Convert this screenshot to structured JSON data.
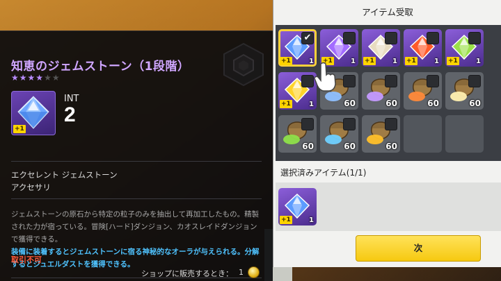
{
  "tooltip": {
    "item_name": "知恵のジェムストーン（1段階）",
    "stars": [
      "on",
      "on",
      "on",
      "on",
      "off",
      "off"
    ],
    "stat": {
      "name": "INT",
      "value": "2"
    },
    "enhance_badge": "+1",
    "category_line1": "エクセレント ジェムストーン",
    "category_line2": "アクセサリ",
    "description": "ジェムストーンの原石から特定の粒子のみを抽出して再加工したもの。精製された力が宿っている。冒険[ハード]ダンジョン、カオスレイドダンジョンで獲得できる。",
    "effect": "装備に装着するとジェムストーンに宿る神秘的なオーラが与えられる。分解するとジュエルダストを獲得できる。",
    "trade_status": "取引不可",
    "sell_label": "ショップに販売するとき：",
    "sell_value": "1"
  },
  "dialog": {
    "title": "アイテム受取",
    "selected_label": "選択済みアイテム(1/1)",
    "next_button": "次"
  },
  "grid": [
    {
      "kind": "gem",
      "gem_color": "#5c9cff",
      "badge": "+1",
      "qty": "1",
      "checked": true
    },
    {
      "kind": "gem",
      "gem_color": "#a26bff",
      "badge": "+1",
      "qty": "1",
      "checked": false
    },
    {
      "kind": "gem",
      "gem_color": "#e8dcc0",
      "badge": "+1",
      "qty": "1",
      "checked": false
    },
    {
      "kind": "gem",
      "gem_color": "#ff5a2a",
      "badge": "+1",
      "qty": "1",
      "checked": false
    },
    {
      "kind": "gem",
      "gem_color": "#9be04a",
      "badge": "+1",
      "qty": "1",
      "checked": false
    },
    {
      "kind": "gem",
      "gem_color": "#ffd42a",
      "badge": "+1",
      "qty": "1",
      "checked": false
    },
    {
      "kind": "dust",
      "gem_color": "#8fc0ff",
      "badge": "",
      "qty": "60",
      "checked": false
    },
    {
      "kind": "dust",
      "gem_color": "#c49aff",
      "badge": "",
      "qty": "60",
      "checked": false
    },
    {
      "kind": "dust",
      "gem_color": "#ff8a3a",
      "badge": "",
      "qty": "60",
      "checked": false
    },
    {
      "kind": "dust",
      "gem_color": "#fff0b0",
      "badge": "",
      "qty": "60",
      "checked": false
    },
    {
      "kind": "dust",
      "gem_color": "#8ee04a",
      "badge": "",
      "qty": "60",
      "checked": false
    },
    {
      "kind": "dust",
      "gem_color": "#6fd0ff",
      "badge": "",
      "qty": "60",
      "checked": false
    },
    {
      "kind": "dust",
      "gem_color": "#ffc02a",
      "badge": "",
      "qty": "60",
      "checked": false
    },
    {
      "kind": "empty"
    },
    {
      "kind": "empty"
    }
  ],
  "selected_items": [
    {
      "gem_color": "#5c9cff",
      "badge": "+1",
      "qty": "1"
    }
  ],
  "colors": {
    "title_purple": "#cfa6ff",
    "warning_red": "#ff5a3a",
    "effect_blue": "#4fc3ff",
    "button_yellow": "#f6c910"
  }
}
